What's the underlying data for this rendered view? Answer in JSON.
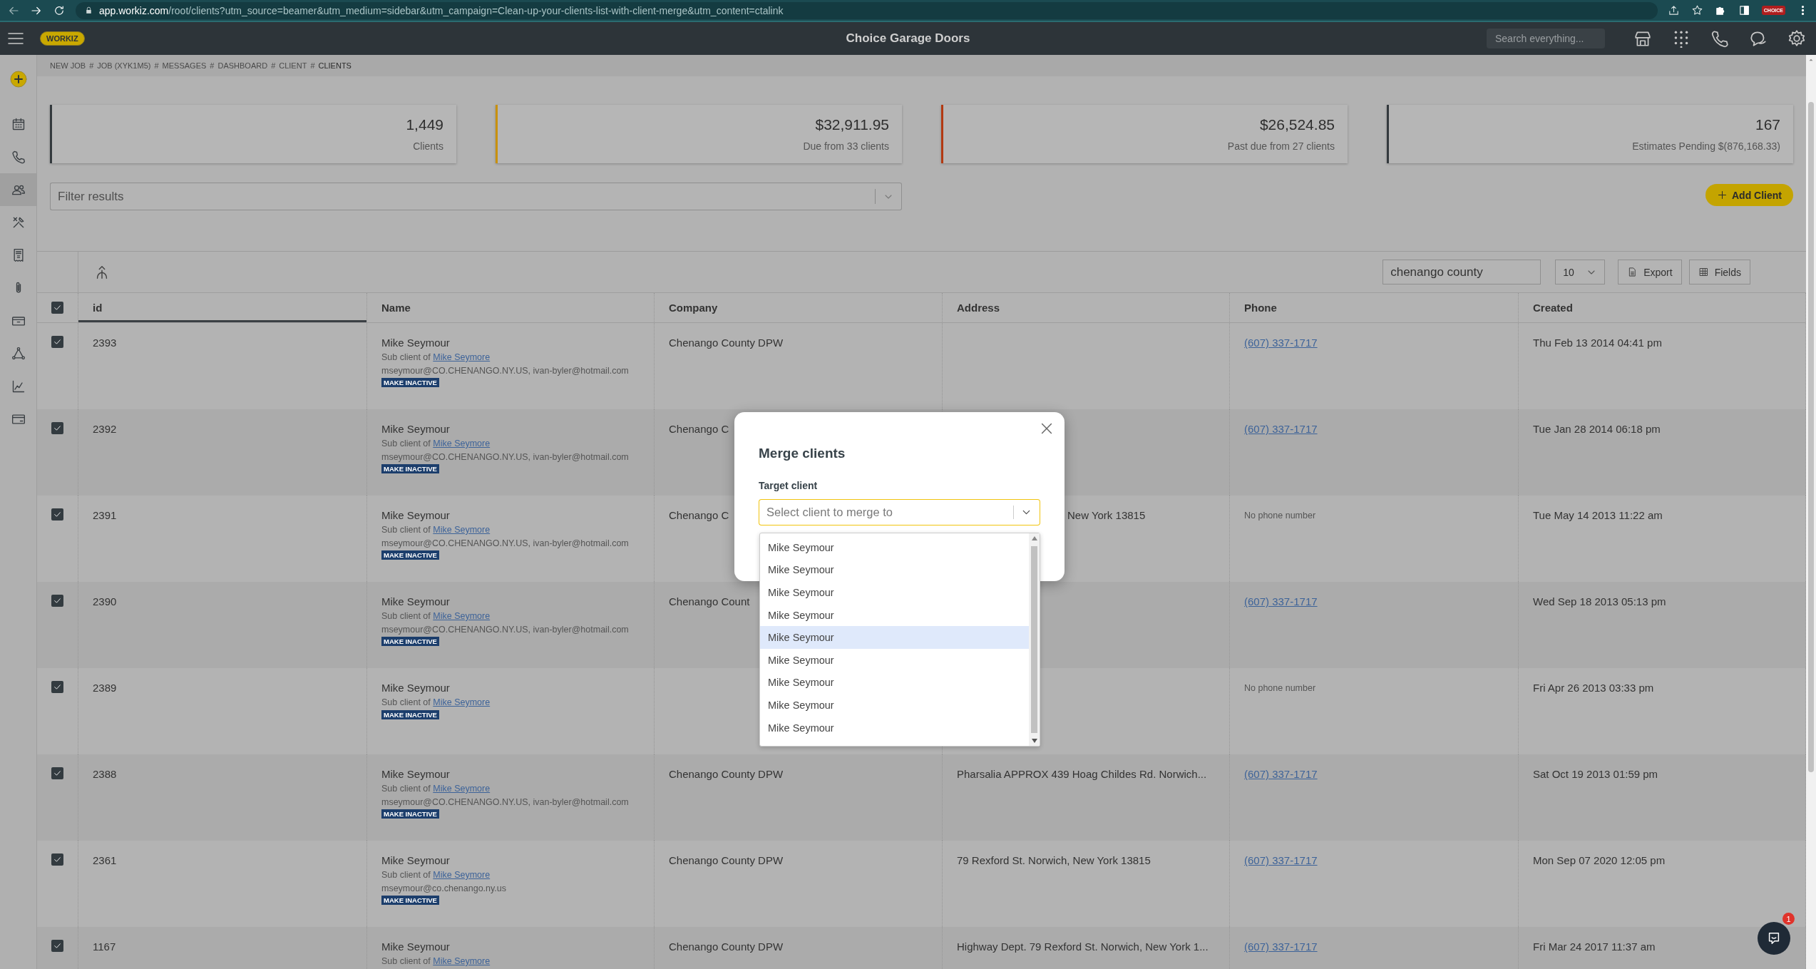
{
  "browser": {
    "url_host": "app.workiz.com",
    "url_path": "/root/clients?utm_source=beamer&utm_medium=sidebar&utm_campaign=Clean-up-your-clients-list-with-client-merge&utm_content=ctalink",
    "profile_badge": "CHOICE"
  },
  "header": {
    "logo": "WORKIZ",
    "title": "Choice Garage Doors",
    "search": {
      "placeholder": "Search everything..."
    }
  },
  "breadcrumb": {
    "separator": "#",
    "items": [
      "NEW JOB",
      "JOB (XYK1M5)",
      "MESSAGES",
      "DASHBOARD",
      "CLIENT",
      "CLIENTS"
    ]
  },
  "sidebar": {
    "items": [
      {
        "selected": false
      },
      {
        "selected": false
      },
      {
        "selected": false
      },
      {
        "selected": true
      },
      {
        "selected": false
      },
      {
        "selected": false
      },
      {
        "selected": false
      },
      {
        "selected": false
      },
      {
        "selected": false
      },
      {
        "selected": false
      },
      {
        "selected": false
      }
    ]
  },
  "stats": [
    {
      "value": "1,449",
      "label": "Clients",
      "color": "#33393d"
    },
    {
      "value": "$32,911.95",
      "label": "Due from 33 clients",
      "color": "#c8900a"
    },
    {
      "value": "$26,524.85",
      "label": "Past due from 27 clients",
      "color": "#b33a12"
    },
    {
      "value": "167",
      "label": "Estimates Pending $(876,168.33)",
      "color": "#33393d"
    }
  ],
  "filter": {
    "placeholder": "Filter results"
  },
  "add_client": {
    "label": "Add Client"
  },
  "table": {
    "search": {
      "value": "chenango county"
    },
    "page_size": "10",
    "export_label": "Export",
    "fields_label": "Fields",
    "all_checked": true,
    "columns": [
      {
        "label": "id",
        "sorted": true
      },
      {
        "label": "Name",
        "sorted": false
      },
      {
        "label": "Company",
        "sorted": false
      },
      {
        "label": "Address",
        "sorted": false
      },
      {
        "label": "Phone",
        "sorted": false
      },
      {
        "label": "Created",
        "sorted": false
      }
    ],
    "rows": [
      {
        "checked": true,
        "id": "2393",
        "name": "Mike Seymour",
        "parent_prefix": "Sub client of",
        "parent": "Mike Seymore",
        "email": "mseymour@CO.CHENANGO.NY.US, ivan-byler@hotmail.com",
        "badge": "MAKE INACTIVE",
        "company": "Chenango County DPW",
        "phone": {
          "kind": "link",
          "text": "(607) 337-1717"
        },
        "created": "Thu Feb 13 2014 04:41 pm"
      },
      {
        "checked": true,
        "id": "2392",
        "name": "Mike Seymour",
        "parent_prefix": "Sub client of",
        "parent": "Mike Seymore",
        "email": "mseymour@CO.CHENANGO.NY.US, ivan-byler@hotmail.com",
        "badge": "MAKE INACTIVE",
        "company": "Chenango C",
        "phone": {
          "kind": "link",
          "text": "(607) 337-1717"
        },
        "created": "Tue Jan 28 2014 06:18 pm"
      },
      {
        "checked": true,
        "id": "2391",
        "name": "Mike Seymour",
        "parent_prefix": "Sub client of",
        "parent": "Mike Seymore",
        "email": "mseymour@CO.CHENANGO.NY.US, ivan-byler@hotmail.com",
        "badge": "MAKE INACTIVE",
        "company": "Chenango C",
        "address": {
          "text": "New York 13815",
          "partial": true
        },
        "phone": {
          "kind": "note",
          "text": "No phone number"
        },
        "created": "Tue May 14 2013 11:22 am"
      },
      {
        "checked": true,
        "id": "2390",
        "name": "Mike Seymour",
        "parent_prefix": "Sub client of",
        "parent": "Mike Seymore",
        "email": "mseymour@CO.CHENANGO.NY.US, ivan-byler@hotmail.com",
        "badge": "MAKE INACTIVE",
        "company": "Chenango Count",
        "phone": {
          "kind": "link",
          "text": "(607) 337-1717"
        },
        "created": "Wed Sep 18 2013 05:13 pm"
      },
      {
        "checked": true,
        "id": "2389",
        "name": "Mike Seymour",
        "parent_prefix": "Sub client of",
        "parent": "Mike Seymore",
        "badge": "MAKE INACTIVE",
        "phone": {
          "kind": "note",
          "text": "No phone number"
        },
        "created": "Fri Apr 26 2013 03:33 pm"
      },
      {
        "checked": true,
        "id": "2388",
        "name": "Mike Seymour",
        "parent_prefix": "Sub client of",
        "parent": "Mike Seymore",
        "email": "mseymour@CO.CHENANGO.NY.US, ivan-byler@hotmail.com",
        "badge": "MAKE INACTIVE",
        "company": "Chenango County DPW",
        "address": {
          "text": "Pharsalia APPROX 439 Hoag Childes Rd. Norwich...",
          "partial": false
        },
        "phone": {
          "kind": "link",
          "text": "(607) 337-1717"
        },
        "created": "Sat Oct 19 2013 01:59 pm"
      },
      {
        "checked": true,
        "id": "2361",
        "name": "Mike Seymour",
        "parent_prefix": "Sub client of",
        "parent": "Mike Seymore",
        "email": "mseymour@co.chenango.ny.us",
        "badge": "MAKE INACTIVE",
        "company": "Chenango County DPW",
        "address": {
          "text": "79 Rexford St. Norwich, New York 13815",
          "partial": false
        },
        "phone": {
          "kind": "link",
          "text": "(607) 337-1717"
        },
        "created": "Mon Sep 07 2020 12:05 pm"
      },
      {
        "checked": true,
        "id": "1167",
        "name": "Mike Seymour",
        "parent_prefix": "Sub client of",
        "parent": "Mike Seymore",
        "company": "Chenango County DPW",
        "address": {
          "text": "Highway Dept. 79 Rexford St. Norwich, New York 1...",
          "partial": false
        },
        "phone": {
          "kind": "link",
          "text": "(607) 337-1717"
        },
        "created": "Fri Mar 24 2017 11:37 am"
      }
    ]
  },
  "modal": {
    "title": "Merge clients",
    "field_label": "Target client",
    "select": {
      "placeholder": "Select client to merge to"
    },
    "options": [
      {
        "label": "Mike Seymour",
        "selected": false
      },
      {
        "label": "Mike Seymour",
        "selected": false
      },
      {
        "label": "Mike Seymour",
        "selected": false
      },
      {
        "label": "Mike Seymour",
        "selected": false
      },
      {
        "label": "Mike Seymour",
        "selected": true
      },
      {
        "label": "Mike Seymour",
        "selected": false
      },
      {
        "label": "Mike Seymour",
        "selected": false
      },
      {
        "label": "Mike Seymour",
        "selected": false
      },
      {
        "label": "Mike Seymour",
        "selected": false
      }
    ]
  },
  "chat": {
    "badge": "1"
  }
}
